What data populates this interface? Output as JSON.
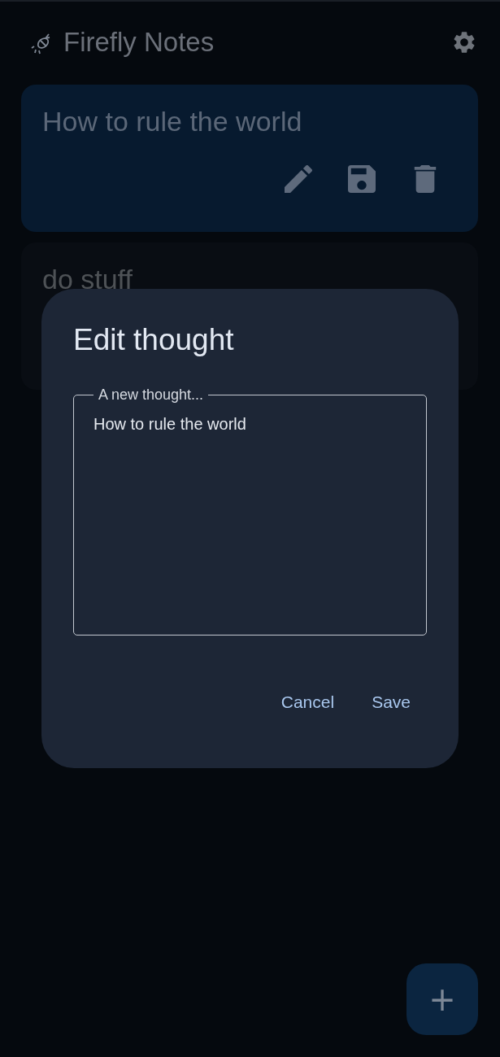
{
  "app_bar": {
    "title": "Firefly Notes"
  },
  "notes": [
    {
      "title": "How to rule the world",
      "selected": true
    },
    {
      "title": "do stuff",
      "selected": false
    }
  ],
  "dialog": {
    "title": "Edit thought",
    "field": {
      "label": "A new thought...",
      "value": "How to rule the world"
    },
    "buttons": [
      "Cancel",
      "Save"
    ]
  },
  "fab": {
    "icon": "+"
  }
}
